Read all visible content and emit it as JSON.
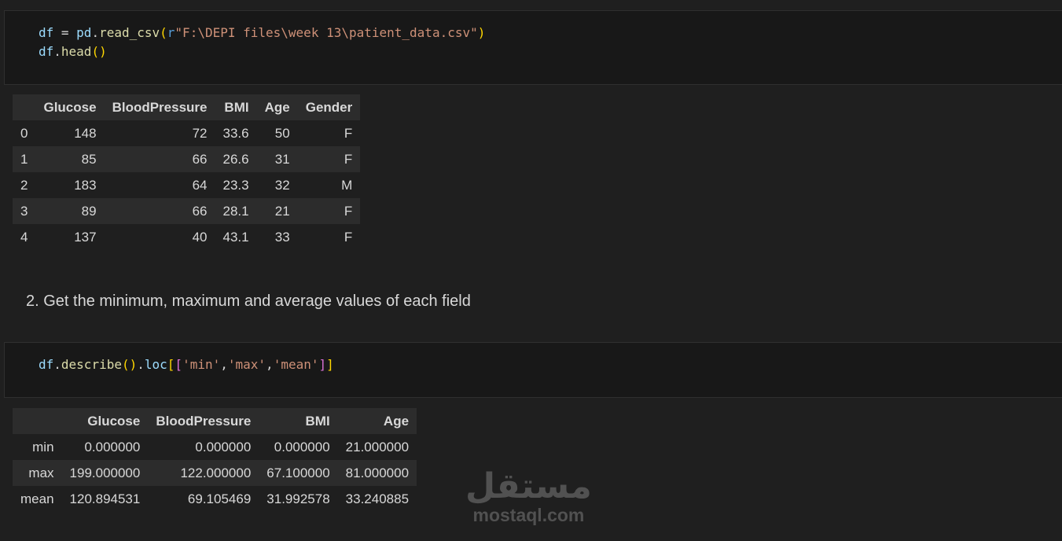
{
  "cell1": {
    "line1": {
      "var": "df",
      "eq": " = ",
      "mod": "pd",
      "dot": ".",
      "fn": "read_csv",
      "lp": "(",
      "prefix": "r",
      "str": "\"F:\\DEPI files\\week 13\\patient_data.csv\"",
      "rp": ")"
    },
    "line2": {
      "var": "df",
      "dot": ".",
      "fn": "head",
      "parens": "()"
    }
  },
  "table1": {
    "columns": [
      "",
      "Glucose",
      "BloodPressure",
      "BMI",
      "Age",
      "Gender"
    ],
    "rows": [
      {
        "index": "0",
        "Glucose": "148",
        "BloodPressure": "72",
        "BMI": "33.6",
        "Age": "50",
        "Gender": "F"
      },
      {
        "index": "1",
        "Glucose": "85",
        "BloodPressure": "66",
        "BMI": "26.6",
        "Age": "31",
        "Gender": "F"
      },
      {
        "index": "2",
        "Glucose": "183",
        "BloodPressure": "64",
        "BMI": "23.3",
        "Age": "32",
        "Gender": "M"
      },
      {
        "index": "3",
        "Glucose": "89",
        "BloodPressure": "66",
        "BMI": "28.1",
        "Age": "21",
        "Gender": "F"
      },
      {
        "index": "4",
        "Glucose": "137",
        "BloodPressure": "40",
        "BMI": "43.1",
        "Age": "33",
        "Gender": "F"
      }
    ]
  },
  "markdown": {
    "heading": "2. Get the minimum, maximum and average values of each field"
  },
  "cell2": {
    "var": "df",
    "dot1": ".",
    "fn1": "describe",
    "p1": "()",
    "dot2": ".",
    "attr": "loc",
    "b1": "[",
    "b2": "[",
    "s1": "'min'",
    "c1": ",",
    "s2": "'max'",
    "c2": ",",
    "s3": "'mean'",
    "b3": "]",
    "b4": "]"
  },
  "table2": {
    "columns": [
      "",
      "Glucose",
      "BloodPressure",
      "BMI",
      "Age"
    ],
    "rows": [
      {
        "index": "min",
        "Glucose": "0.000000",
        "BloodPressure": "0.000000",
        "BMI": "0.000000",
        "Age": "21.000000"
      },
      {
        "index": "max",
        "Glucose": "199.000000",
        "BloodPressure": "122.000000",
        "BMI": "67.100000",
        "Age": "81.000000"
      },
      {
        "index": "mean",
        "Glucose": "120.894531",
        "BloodPressure": "69.105469",
        "BMI": "31.992578",
        "Age": "33.240885"
      }
    ]
  },
  "watermark": {
    "arabic": "مستقل",
    "latin": "mostaql.com"
  }
}
